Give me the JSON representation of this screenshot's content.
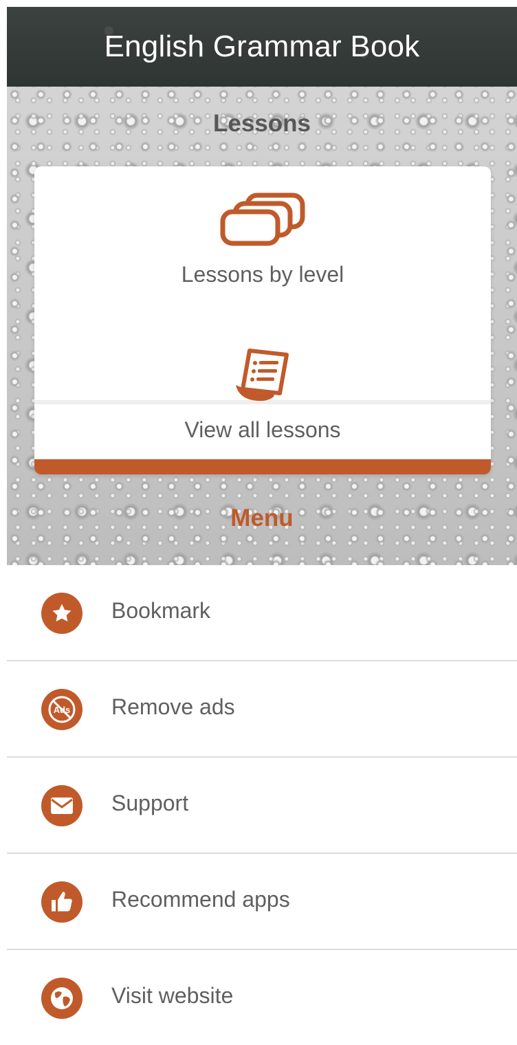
{
  "header": {
    "title": "English Grammar Book"
  },
  "lessons": {
    "section_title": "Lessons",
    "items": [
      {
        "label": "Lessons by level",
        "icon": "stacked-cards-icon"
      },
      {
        "label": "View all lessons",
        "icon": "document-list-icon"
      }
    ]
  },
  "menu": {
    "section_title": "Menu",
    "items": [
      {
        "label": "Bookmark",
        "icon": "star-icon"
      },
      {
        "label": "Remove ads",
        "icon": "no-ads-icon"
      },
      {
        "label": "Support",
        "icon": "envelope-icon"
      },
      {
        "label": "Recommend apps",
        "icon": "thumbs-up-icon"
      },
      {
        "label": "Visit website",
        "icon": "globe-icon"
      }
    ]
  },
  "colors": {
    "accent": "#c05a2a",
    "header_bg": "#363c3a",
    "text": "#5f5f5f"
  }
}
